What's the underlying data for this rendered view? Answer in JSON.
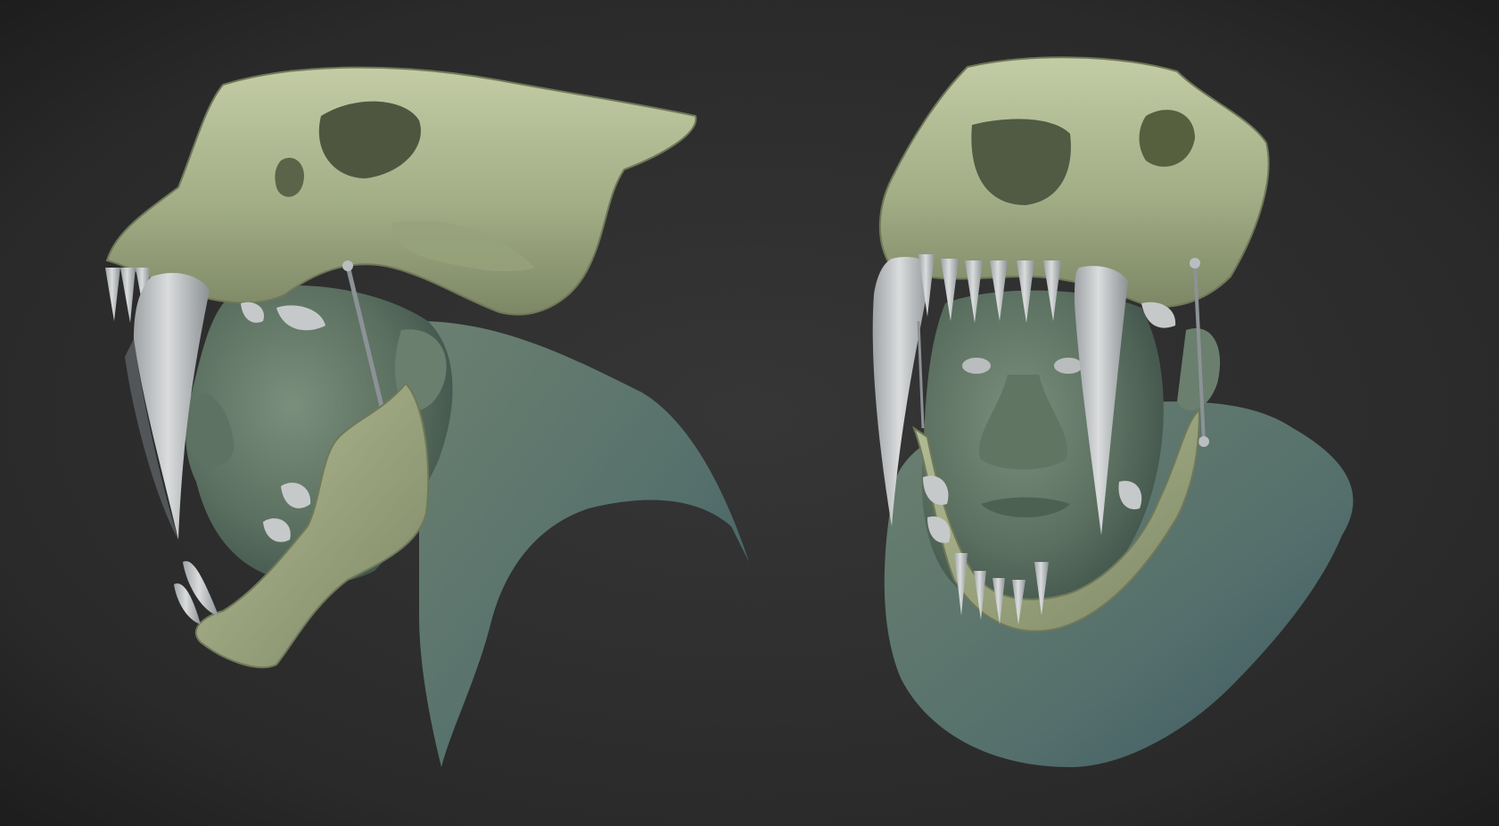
{
  "scene": {
    "background_color": "#2b2b2b",
    "vignette_color": "#1c1c1c",
    "skull_color": "#a9b58e",
    "skin_color": "#5f7563",
    "teeth_color": "#c9cccd",
    "renders": [
      {
        "view": "side"
      },
      {
        "view": "front"
      }
    ]
  }
}
